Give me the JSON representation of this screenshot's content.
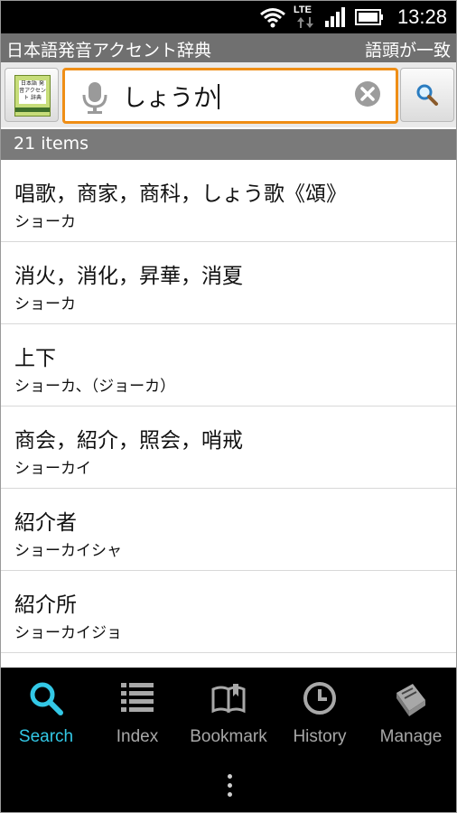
{
  "status": {
    "time": "13:28",
    "network": "LTE"
  },
  "titlebar": {
    "app_title": "日本語発音アクセント辞典",
    "mode": "語頭が一致"
  },
  "search": {
    "query": "しょうか",
    "book_label": "日本語 発音アクセント 辞典"
  },
  "results": {
    "count_label": "21 items",
    "items": [
      {
        "word": "唱歌，商家，商科，しょう歌《頌》",
        "reading": "ショーカ"
      },
      {
        "word": "消火，消化，昇華，消夏",
        "reading": "ショーカ"
      },
      {
        "word": "上下",
        "reading": "ショーカ、（ジョーカ）"
      },
      {
        "word": "商会，紹介，照会，哨戒",
        "reading": "ショーカイ"
      },
      {
        "word": "紹介者",
        "reading": "ショーカイシャ"
      },
      {
        "word": "紹介所",
        "reading": "ショーカイジョ"
      },
      {
        "word": "",
        "reading": ""
      }
    ]
  },
  "nav": {
    "tabs": [
      {
        "label": "Search",
        "icon": "search-icon",
        "active": true
      },
      {
        "label": "Index",
        "icon": "list-icon",
        "active": false
      },
      {
        "label": "Bookmark",
        "icon": "open-book-icon",
        "active": false
      },
      {
        "label": "History",
        "icon": "clock-icon",
        "active": false
      },
      {
        "label": "Manage",
        "icon": "manage-book-icon",
        "active": false
      }
    ]
  },
  "colors": {
    "accent": "#33c8e6",
    "search_border": "#ef8e16",
    "bar_gray": "#707070"
  }
}
